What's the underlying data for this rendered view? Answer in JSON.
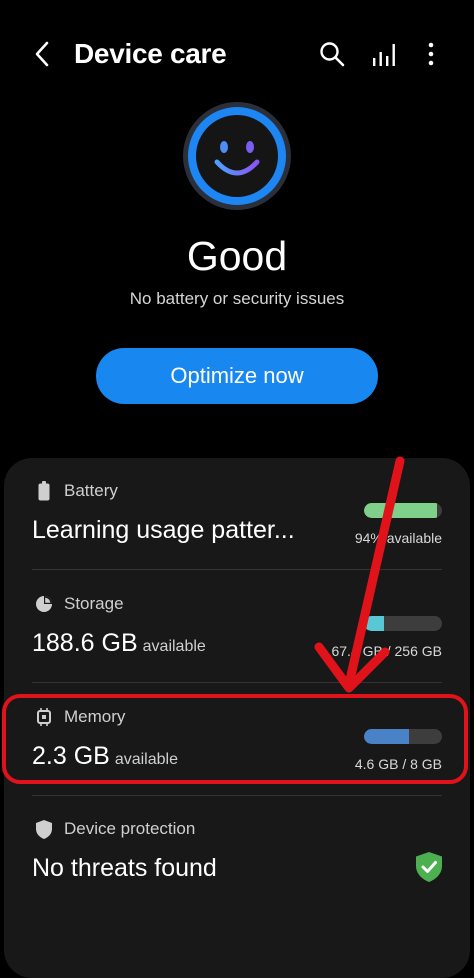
{
  "header": {
    "title": "Device care"
  },
  "status": {
    "label": "Good",
    "subtitle": "No battery or security issues"
  },
  "optimize": {
    "label": "Optimize now"
  },
  "battery": {
    "title": "Battery",
    "main": "Learning usage patter...",
    "caption": "94% available",
    "level": 0.94,
    "color": "#7fd08a"
  },
  "storage": {
    "title": "Storage",
    "value": "188.6 GB",
    "unit": "available",
    "caption": "67.4 GB / 256 GB",
    "used_fraction": 0.26,
    "color": "#58c8d6"
  },
  "memory": {
    "title": "Memory",
    "value": "2.3 GB",
    "unit": "available",
    "caption": "4.6 GB / 8 GB",
    "used_fraction": 0.58,
    "color": "#4a82c8"
  },
  "protection": {
    "title": "Device protection",
    "main": "No threats found",
    "icon_color": "#4caf50"
  },
  "annotation": {
    "color": "#e0131b"
  }
}
